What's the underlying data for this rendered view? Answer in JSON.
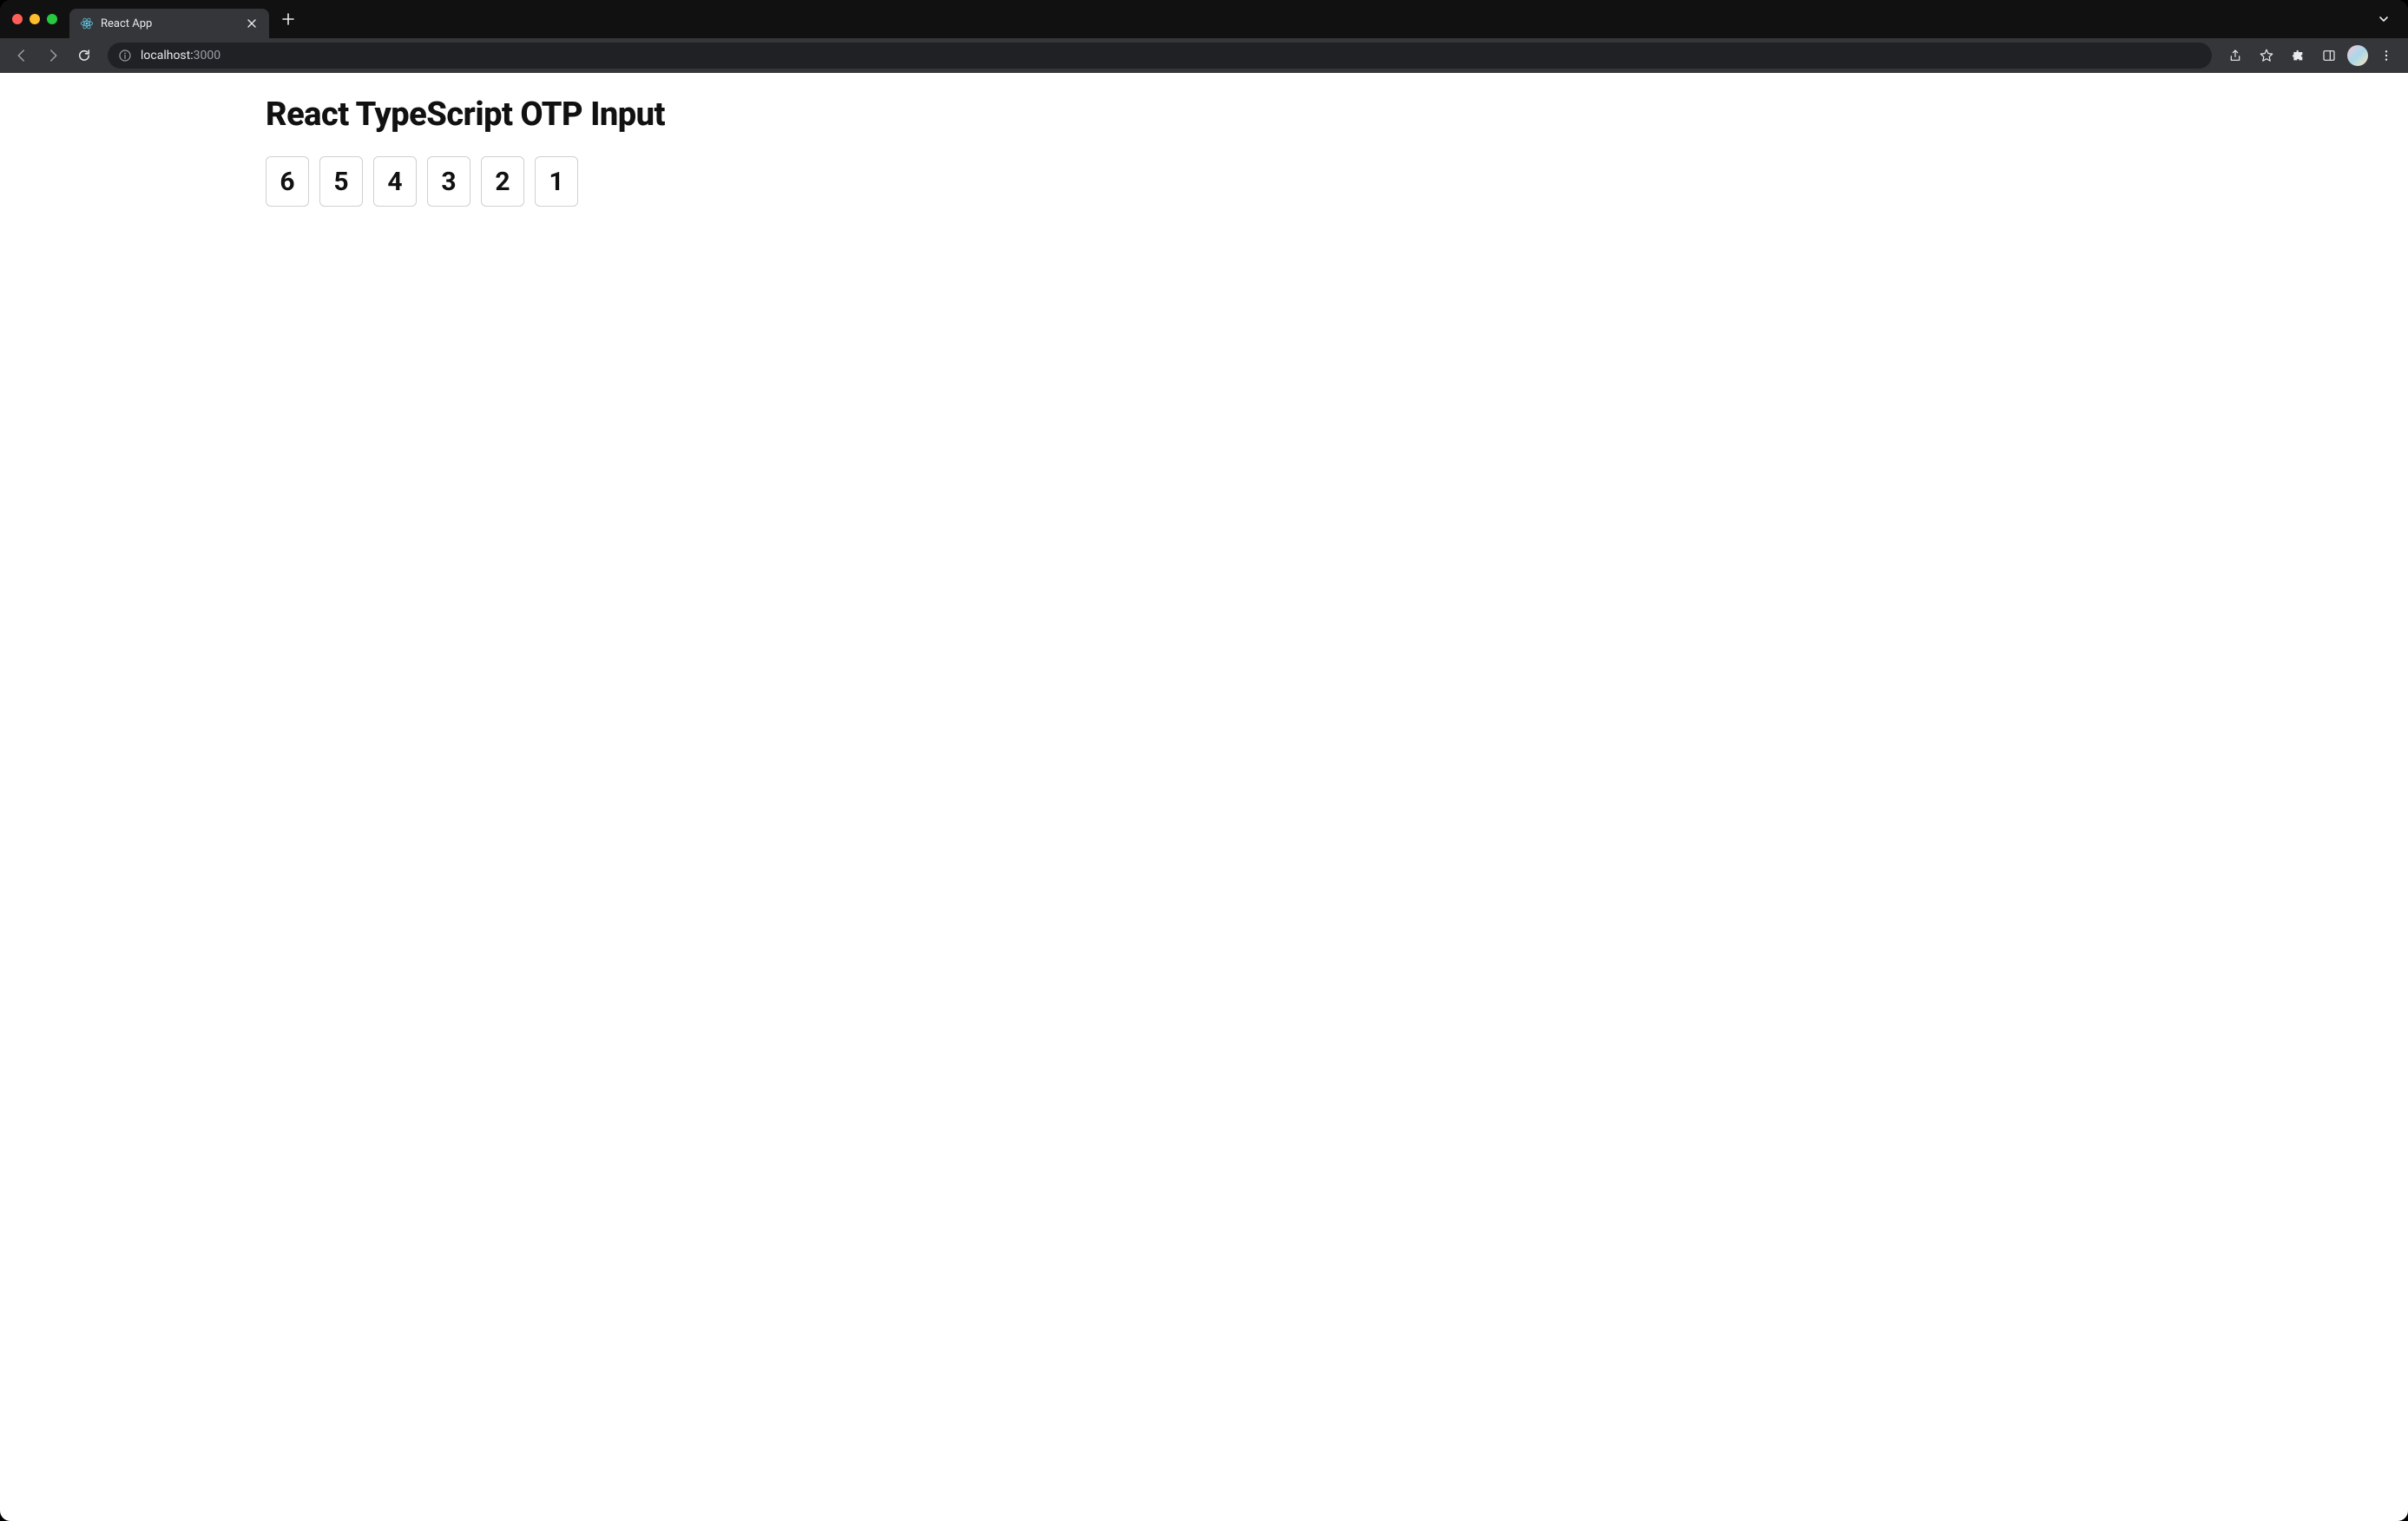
{
  "browser": {
    "tab": {
      "title": "React App",
      "favicon_name": "react-logo-icon"
    },
    "address": {
      "host": "localhost:",
      "port": "3000"
    }
  },
  "page": {
    "heading": "React TypeScript OTP Input",
    "otp": [
      "6",
      "5",
      "4",
      "3",
      "2",
      "1"
    ]
  }
}
